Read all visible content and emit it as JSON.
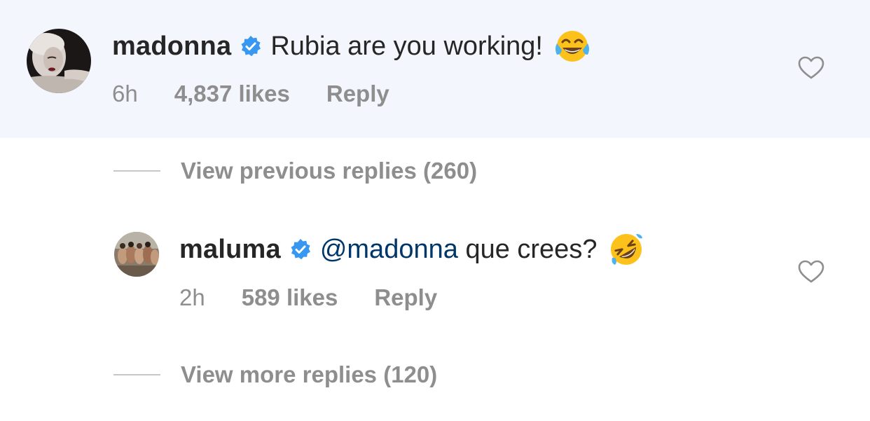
{
  "comment": {
    "username": "madonna",
    "verified_icon": "verified-badge-icon",
    "text": "Rubia are you working!",
    "emoji": "face-with-tears-of-joy-emoji",
    "time": "6h",
    "likes": "4,837 likes",
    "reply_label": "Reply",
    "like_icon": "heart-outline-icon",
    "background_color": "#f3f7fd"
  },
  "view_previous": {
    "label": "View previous replies (260)"
  },
  "reply": {
    "username": "maluma",
    "verified_icon": "verified-badge-icon",
    "mention": "@madonna",
    "text": "que crees?",
    "emoji": "rolling-on-the-floor-laughing-emoji",
    "time": "2h",
    "likes": "589 likes",
    "reply_label": "Reply",
    "like_icon": "heart-outline-icon"
  },
  "view_more": {
    "label": "View more replies (120)"
  },
  "colors": {
    "text": "#262626",
    "secondary": "#8e8e8e",
    "verified": "#3897f0",
    "mention": "#00376b"
  }
}
